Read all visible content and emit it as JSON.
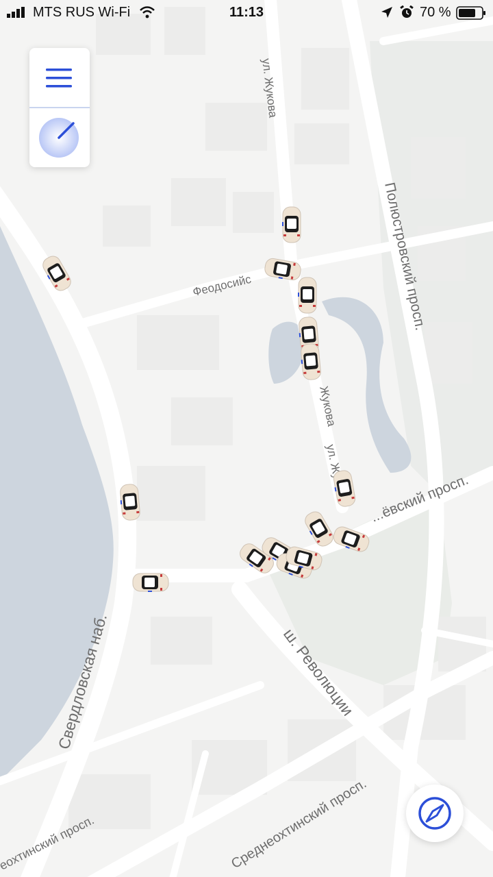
{
  "status_bar": {
    "carrier": "MTS RUS Wi-Fi",
    "time": "11:13",
    "battery": "70 %"
  },
  "map": {
    "streets": [
      {
        "id": "zhukova-north",
        "label": "ул. Жукова"
      },
      {
        "id": "zhukova-mid",
        "label": "Жукова"
      },
      {
        "id": "zhukova-south",
        "label": "ул. Жукова"
      },
      {
        "id": "feodosiyskaya",
        "label": "Феодосийс"
      },
      {
        "id": "polyustrovsky",
        "label": "Полюстровский просп."
      },
      {
        "id": "...evsky",
        "label": "...ёвский просп."
      },
      {
        "id": "sverdlovskaya",
        "label": "Свердловская наб."
      },
      {
        "id": "revolyutsii",
        "label": "ш. Революции"
      },
      {
        "id": "sredneokhtinsky",
        "label": "Среднеохтинский просп."
      },
      {
        "id": "okhtinsky-left",
        "label": "еохтинский просп."
      }
    ],
    "car_count": 17
  },
  "controls": {
    "menu": "menu-icon",
    "radar": "radar-icon",
    "compass": "compass-icon"
  },
  "colors": {
    "accent": "#2c4fd8",
    "water": "#cbd4de",
    "park": "#e9ece8"
  }
}
